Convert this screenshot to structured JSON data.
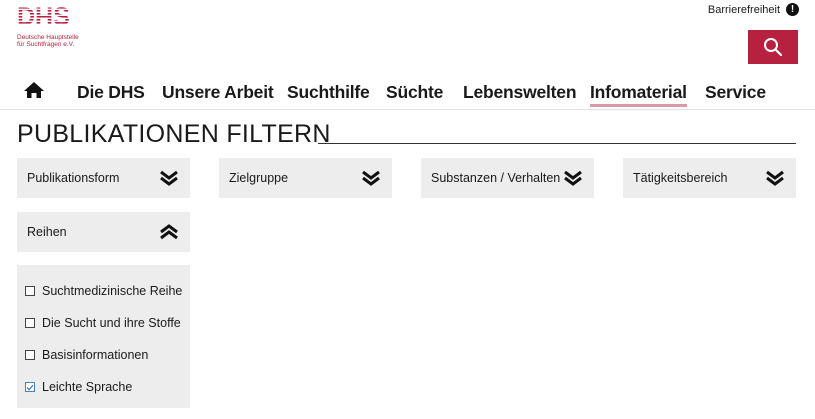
{
  "logo": {
    "mark": "DHS",
    "subtitle_line1": "Deutsche Hauptstelle",
    "subtitle_line2": "für Suchtfragen e.V."
  },
  "header": {
    "accessibility_label": "Barrierefreiheit",
    "accessibility_icon": "exclamation-circle-icon",
    "search_icon": "search-icon",
    "accent_color": "#b5213f"
  },
  "nav": {
    "home_icon": "home-icon",
    "items": [
      {
        "label": "Die DHS"
      },
      {
        "label": "Unsere Arbeit"
      },
      {
        "label": "Suchthilfe"
      },
      {
        "label": "Süchte"
      },
      {
        "label": "Lebenswelten"
      },
      {
        "label": "Infomaterial",
        "active": true
      },
      {
        "label": "Service"
      }
    ]
  },
  "page": {
    "title": "PUBLIKATIONEN FILTERN"
  },
  "filters": [
    {
      "label": "Publikationsform",
      "expanded": false
    },
    {
      "label": "Zielgruppe",
      "expanded": false
    },
    {
      "label": "Substanzen / Verhalten",
      "expanded": false
    },
    {
      "label": "Tätigkeitsbereich",
      "expanded": false
    },
    {
      "label": "Reihen",
      "expanded": true
    }
  ],
  "reihen_options": [
    {
      "label": "Suchtmedizinische Reihe",
      "checked": false
    },
    {
      "label": "Die Sucht und ihre Stoffe",
      "checked": false
    },
    {
      "label": "Basisinformationen",
      "checked": false
    },
    {
      "label": "Leichte Sprache",
      "checked": true
    }
  ]
}
